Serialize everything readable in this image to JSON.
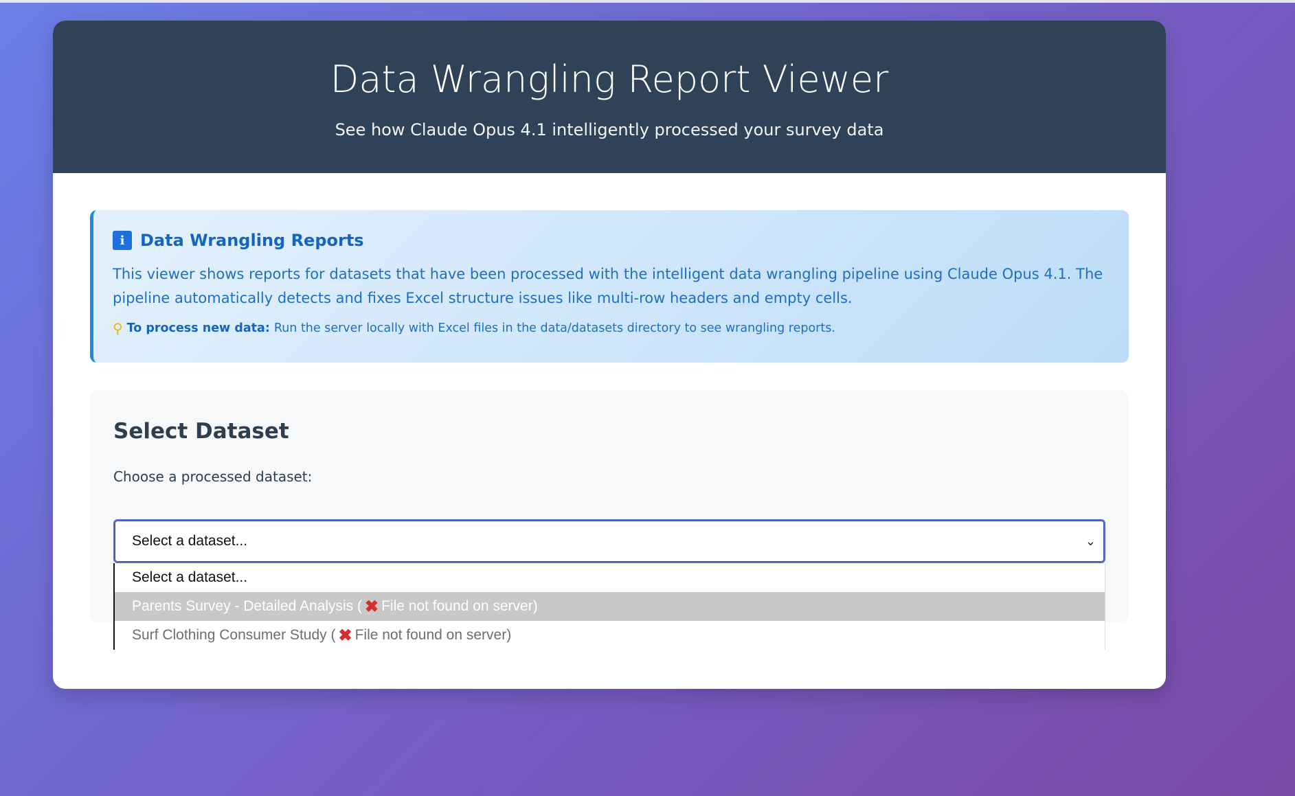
{
  "header": {
    "title": "Data Wrangling Report Viewer",
    "subtitle": "See how Claude Opus 4.1 intelligently processed your survey data"
  },
  "info": {
    "icon": "info-icon",
    "title": "Data Wrangling Reports",
    "text": "This viewer shows reports for datasets that have been processed with the intelligent data wrangling pipeline using Claude Opus 4.1. The pipeline automatically detects and fixes Excel structure issues like multi-row headers and empty cells.",
    "tip_icon": "lightbulb-icon",
    "tip_label": "To process new data:",
    "tip_text": "Run the server locally with Excel files in the data/datasets directory to see wrangling reports."
  },
  "select_section": {
    "heading": "Select Dataset",
    "label": "Choose a processed dataset:",
    "selected": "Select a dataset...",
    "options": [
      {
        "prefix": "Select a dataset...",
        "suffix": ""
      },
      {
        "prefix": "Parents Survey - Detailed Analysis (",
        "suffix": "File not found on server)",
        "icon": "cross-mark-icon"
      },
      {
        "prefix": "Surf Clothing Consumer Study (",
        "suffix": "File not found on server)",
        "icon": "cross-mark-icon"
      }
    ]
  },
  "colors": {
    "header_bg": "#2f4257",
    "accent": "#1e88e5",
    "error": "#d32f2f"
  }
}
